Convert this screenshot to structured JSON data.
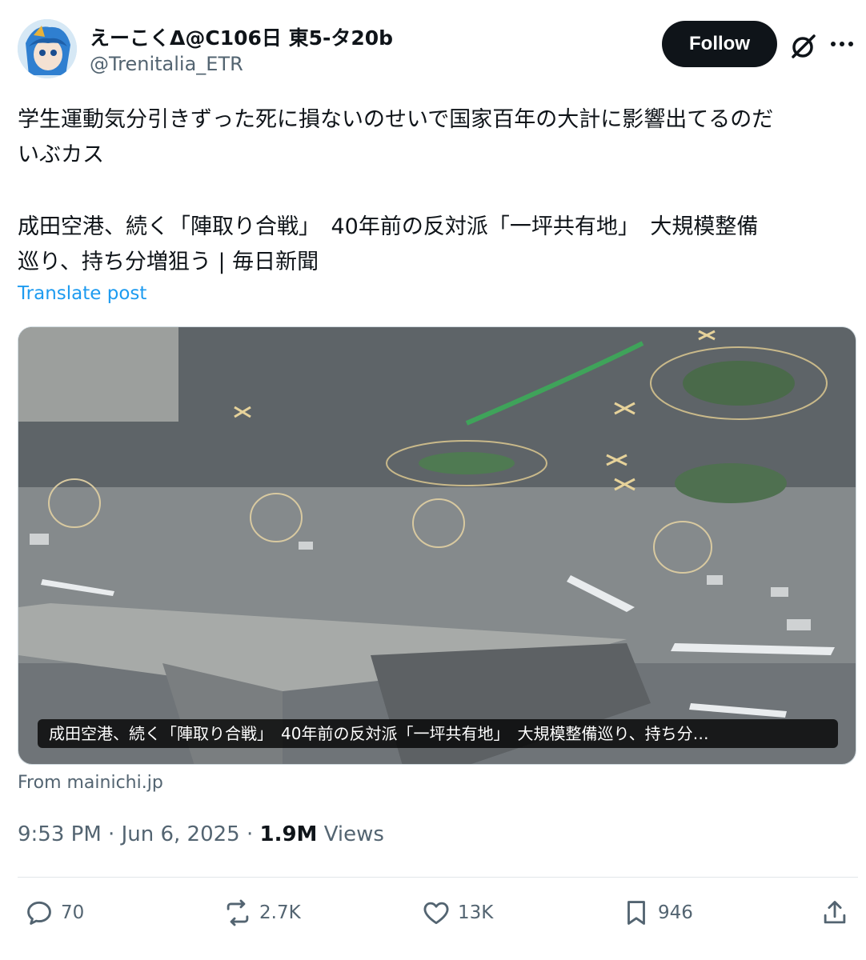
{
  "author": {
    "display_name": "えーこくΔ@C106日 東5-タ20b",
    "handle": "@Trenitalia_ETR",
    "avatar_icon": "anime-avatar-icon"
  },
  "header": {
    "follow_label": "Follow",
    "grok_icon": "grok-icon",
    "more_icon": "more-icon"
  },
  "post": {
    "text_line1": "学生運動気分引きずった死に損ないのせいで国家百年の大計に影響出てるのだ",
    "text_line2": "いぶカス",
    "link_line1": "成田空港、続く「陣取り合戦」　40年前の反対派「一坪共有地」　大規模整備",
    "link_line2": "巡り、持ち分増狙う | 毎日新聞",
    "translate_label": "Translate post"
  },
  "card": {
    "caption": "成田空港、続く「陣取り合戦」　40年前の反対派「一坪共有地」　大規模整備巡り、持ち分…",
    "source": "From mainichi.jp"
  },
  "meta": {
    "time": "9:53 PM",
    "sep1": " · ",
    "date": "Jun 6, 2025",
    "sep2": " · ",
    "views_count": "1.9M",
    "views_label": " Views"
  },
  "actions": {
    "replies": "70",
    "reposts": "2.7K",
    "likes": "13K",
    "bookmarks": "946"
  },
  "colors": {
    "link_blue": "#1d9bf0",
    "secondary_text": "#536471",
    "follow_bg": "#0f1419"
  }
}
